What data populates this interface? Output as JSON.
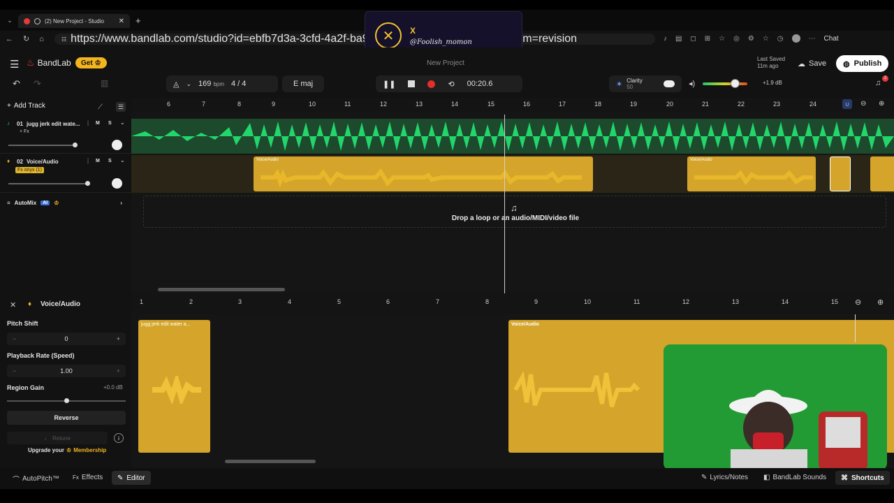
{
  "browser": {
    "tab_title": "(2) New Project - Studio",
    "url": "https://www.bandlab.com/studio?id=ebfb7d3a-3cfd-4a2f-ba98-d5a8861c84c9&triggered_from=revision",
    "chat_label": "Chat"
  },
  "notification": {
    "title": "X",
    "handle": "@Foolish_momon"
  },
  "app": {
    "brand": "BandLab",
    "get_label": "Get",
    "project_title": "New Project",
    "bpm_value": "169",
    "bpm_unit": "bpm",
    "time_signature": "4 / 4",
    "key": "E maj",
    "time_display": "00:20.6",
    "clarity_label": "Clarity",
    "clarity_sub": "50",
    "db_value": "+1.9 dB",
    "last_saved_line1": "Last Saved",
    "last_saved_line2": "11m ago",
    "save_label": "Save",
    "publish_label": "Publish",
    "notification_count": "2"
  },
  "tracks_panel": {
    "add_track_label": "Add Track",
    "tracks": [
      {
        "number": "01",
        "name": "jugg jerk edit wate...",
        "fx": "+ Fx",
        "m": "M",
        "s": "S"
      },
      {
        "number": "02",
        "name": "Voice/Audio",
        "fx": "Fx onyx (1)",
        "m": "M",
        "s": "S"
      }
    ],
    "automix_label": "AutoMix",
    "automix_badge": "AI"
  },
  "timeline": {
    "ruler": [
      "6",
      "7",
      "8",
      "9",
      "10",
      "11",
      "12",
      "13",
      "14",
      "15",
      "16",
      "17",
      "18",
      "19",
      "20",
      "21",
      "22",
      "23",
      "24"
    ],
    "region_label": "Voice/Audio",
    "drop_text": "Drop a loop or an audio/MIDI/video file"
  },
  "editor": {
    "title": "Voice/Audio",
    "pitch_shift_label": "Pitch Shift",
    "pitch_shift_value": "0",
    "playback_rate_label": "Playback Rate (Speed)",
    "playback_rate_value": "1.00",
    "region_gain_label": "Region Gain",
    "region_gain_value": "+0.0 dB",
    "reverse_label": "Reverse",
    "retune_label": "Retune",
    "upgrade_text": "Upgrade your",
    "membership_label": "Membership",
    "ruler": [
      "1",
      "2",
      "3",
      "4",
      "5",
      "6",
      "7",
      "8",
      "9",
      "10",
      "11",
      "12",
      "13",
      "14",
      "15"
    ],
    "clip1_label": "jugg jerk edit water a...",
    "clip2_label": "Voice/Audio"
  },
  "footer": {
    "autopitch_label": "AutoPitch™",
    "effects_label": "Effects",
    "editor_label": "Editor",
    "lyrics_label": "Lyrics/Notes",
    "sounds_label": "BandLab Sounds",
    "shortcuts_label": "Shortcuts"
  },
  "colors": {
    "accent_red": "#ff3d3d",
    "green_wave": "#22d66b",
    "yellow_wave": "#e2b52a",
    "brand_gold": "#f2b51d"
  }
}
